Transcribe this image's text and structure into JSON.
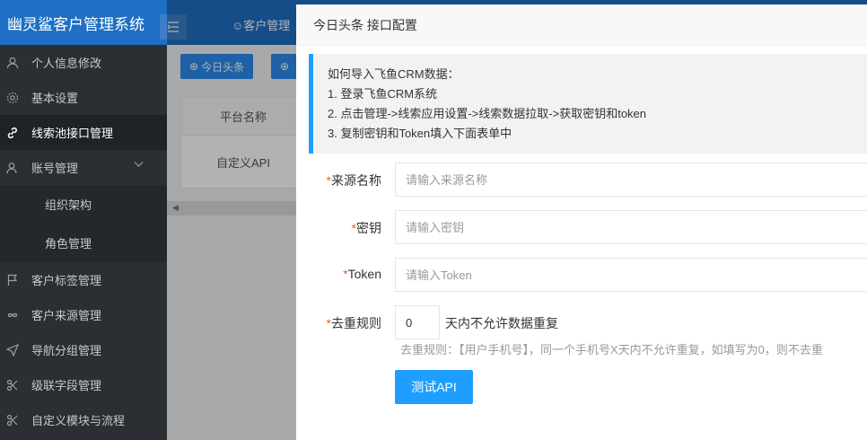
{
  "sidebar": {
    "brand": "幽灵鲨客户管理系统",
    "items": [
      {
        "label": "个人信息修改",
        "icon": "user-icon"
      },
      {
        "label": "基本设置",
        "icon": "gear-icon"
      },
      {
        "label": "线索池接口管理",
        "icon": "link-icon",
        "active": true
      },
      {
        "label": "账号管理",
        "icon": "users-icon",
        "expanded": true
      },
      {
        "label": "组织架构",
        "sub": true
      },
      {
        "label": "角色管理",
        "sub": true
      },
      {
        "label": "客户标签管理",
        "icon": "flag-icon"
      },
      {
        "label": "客户来源管理",
        "icon": "infinity-icon"
      },
      {
        "label": "导航分组管理",
        "icon": "send-icon"
      },
      {
        "label": "级联字段管理",
        "icon": "scissors-icon"
      },
      {
        "label": "自定义模块与流程",
        "icon": "scissors-icon"
      }
    ]
  },
  "topbar": {
    "nav_label": "客户管理"
  },
  "background": {
    "add_button_label": "今日头条",
    "table_header": "平台名称",
    "table_cell": "自定义API"
  },
  "drawer": {
    "title": "今日头条 接口配置",
    "notice": {
      "line1": "如何导入飞鱼CRM数据：",
      "line2": "1. 登录飞鱼CRM系统",
      "line3": "2. 点击管理->线索应用设置->线索数据拉取->获取密钥和token",
      "line4": "3. 复制密钥和Token填入下面表单中"
    },
    "form": {
      "source_name": {
        "label": "来源名称",
        "placeholder": "请输入来源名称",
        "value": ""
      },
      "secret": {
        "label": "密钥",
        "placeholder": "请输入密钥",
        "value": ""
      },
      "token": {
        "label": "Token",
        "placeholder": "请输入Token",
        "value": ""
      },
      "dedupe": {
        "label": "去重规则",
        "value": "0",
        "unit": "天内不允许数据重复",
        "hint": "去重规则：【用户手机号】，同一个手机号X天内不允许重复，如填写为0，则不去重"
      },
      "required_mark": "*",
      "test_button": "测试API"
    }
  }
}
